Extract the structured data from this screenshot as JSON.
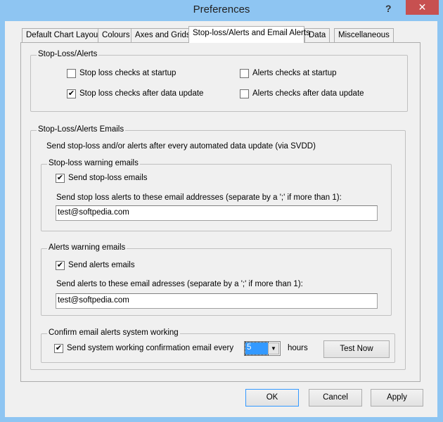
{
  "window": {
    "title": "Preferences",
    "help": "?",
    "close": "✕"
  },
  "tabs": [
    "Default Chart Layout",
    "Colours",
    "Axes and Grids",
    "Stop-loss/Alerts and Email Alerts",
    "Data",
    "Miscellaneous"
  ],
  "alerts": {
    "legend": "Stop-Loss/Alerts",
    "sl_startup": {
      "label": "Stop loss checks at startup",
      "checked": false
    },
    "sl_update": {
      "label": "Stop loss checks after data update",
      "checked": true
    },
    "al_startup": {
      "label": "Alerts checks at startup",
      "checked": false
    },
    "al_update": {
      "label": "Alerts checks after data update",
      "checked": false
    }
  },
  "emails": {
    "legend": "Stop-Loss/Alerts Emails",
    "desc": "Send stop-loss and/or alerts after every automated data update (via SVDD)",
    "stoploss": {
      "legend": "Stop-loss warning emails",
      "send_label": "Send stop-loss emails",
      "send_checked": true,
      "addr_label": "Send stop loss alerts to these email addresses (separate by a ';' if more than 1):",
      "addr_value": "test@softpedia.com"
    },
    "alerts": {
      "legend": "Alerts warning emails",
      "send_label": "Send alerts emails",
      "send_checked": true,
      "addr_label": "Send alerts to these email adresses (separate by a ';' if more than 1):",
      "addr_value": "test@softpedia.com"
    },
    "confirm": {
      "legend": "Confirm email alerts system working",
      "send_label": "Send system working confirmation email every",
      "send_checked": true,
      "hours_value": "5",
      "hours_label": "hours",
      "test_button": "Test Now"
    }
  },
  "buttons": {
    "ok": "OK",
    "cancel": "Cancel",
    "apply": "Apply"
  },
  "check": "✔"
}
